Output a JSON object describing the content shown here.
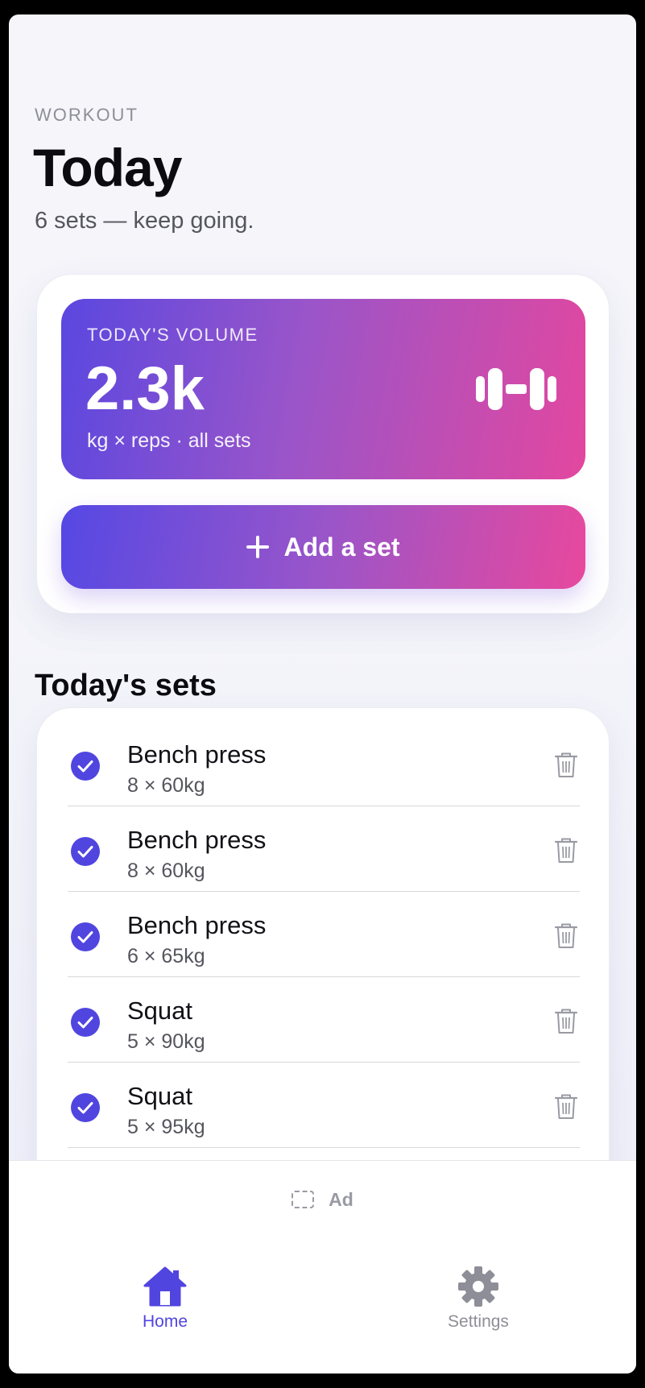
{
  "header": {
    "eyebrow": "WORKOUT",
    "title": "Today",
    "subtitle": "6 sets — keep going."
  },
  "volume": {
    "label": "TODAY'S VOLUME",
    "value": "2.3k",
    "caption": "kg × reps · all sets",
    "icon": "dumbbell-icon"
  },
  "add_button": {
    "label": "Add a set",
    "icon": "plus-icon"
  },
  "sets_section": {
    "title": "Today's sets",
    "items": [
      {
        "name": "Bench press",
        "detail": "8 × 60kg",
        "done": true
      },
      {
        "name": "Bench press",
        "detail": "8 × 60kg",
        "done": true
      },
      {
        "name": "Bench press",
        "detail": "6 × 65kg",
        "done": true
      },
      {
        "name": "Squat",
        "detail": "5 × 90kg",
        "done": true
      },
      {
        "name": "Squat",
        "detail": "5 × 95kg",
        "done": true
      }
    ]
  },
  "ad": {
    "label": "Ad"
  },
  "tabs": [
    {
      "label": "Home",
      "icon": "house-icon",
      "active": true
    },
    {
      "label": "Settings",
      "icon": "gear-icon",
      "active": false
    }
  ],
  "colors": {
    "accent": "#5145e0",
    "gradient_start": "#5548e4",
    "gradient_end": "#e8489d",
    "inactive": "#8e8e98"
  }
}
